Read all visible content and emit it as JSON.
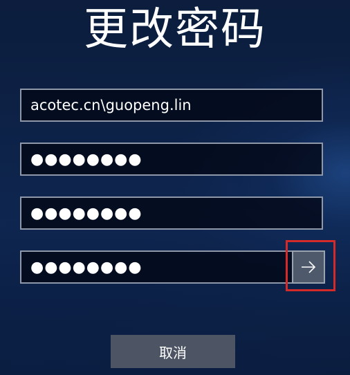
{
  "header": {
    "title": "更改密码"
  },
  "form": {
    "username_value": "acotec.cn\\guopeng.lin",
    "old_password_masked": "●●●●●●●●",
    "new_password_masked": "●●●●●●●●",
    "confirm_password_masked": "●●●●●●●●"
  },
  "actions": {
    "submit_icon": "arrow-right-icon",
    "cancel_label": "取消"
  },
  "colors": {
    "background": "#0d2247",
    "field_border": "#8e98a8",
    "button_bg": "#4d5564",
    "highlight": "#d42a2a"
  }
}
